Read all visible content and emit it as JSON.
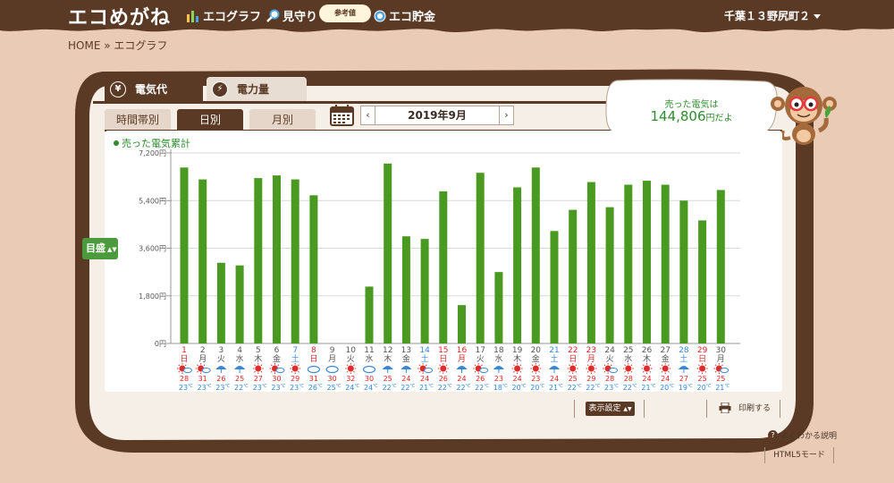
{
  "header": {
    "logo": "エコめがね",
    "nav": [
      {
        "label": "エコグラフ",
        "icon": "bar-chart-icon"
      },
      {
        "label": "見守り",
        "icon": "magnifier-icon"
      },
      {
        "label": "エコ貯金",
        "icon": "coin-icon"
      }
    ],
    "sample_badge": "参考値",
    "user_name": "千葉１３野尻町２"
  },
  "breadcrumb": "HOME » エコグラフ",
  "main_tabs": [
    {
      "label": "電気代",
      "icon_glyph": "¥",
      "icon": "yen-icon",
      "active": true
    },
    {
      "label": "電力量",
      "icon_glyph": "⚡",
      "icon": "lightning-icon",
      "active": false
    }
  ],
  "period_tabs": [
    {
      "label": "時間帯別",
      "active": false
    },
    {
      "label": "日別",
      "active": true
    },
    {
      "label": "月別",
      "active": false
    }
  ],
  "month_nav": {
    "prev": "‹",
    "label": "2019年9月",
    "next": "›"
  },
  "summary": {
    "line1": "売った電気は",
    "amount": "144,806",
    "suffix": "円だよ"
  },
  "legend": "売った電気累計",
  "scale_button": "目盛",
  "bottom": {
    "display_settings": "表示設定",
    "print": "印刷する",
    "help": "よくわかる説明",
    "html5": "HTML5モード"
  },
  "colors": {
    "brand_brown": "#5a3a25",
    "bar_green": "#4a9a22",
    "saturday_blue": "#3a87d9",
    "sunday_red": "#d9262a"
  },
  "chart_data": {
    "type": "bar",
    "ylim": [
      0,
      7200
    ],
    "yticks": [
      "0円",
      "1,800円",
      "3,600円",
      "5,400円",
      "7,200円"
    ],
    "ytick_values": [
      0,
      1800,
      3600,
      5400,
      7200
    ],
    "series": [
      {
        "name": "売った電気累計",
        "values": [
          6650,
          6200,
          3050,
          2950,
          6250,
          6350,
          6200,
          5600,
          0,
          0,
          2150,
          6800,
          4050,
          3950,
          5750,
          1450,
          6450,
          2700,
          5900,
          6650,
          4250,
          5050,
          6100,
          5150,
          6000,
          6150,
          6000,
          5400,
          4650,
          5800
        ]
      }
    ],
    "days": [
      {
        "day": "1",
        "weekday": "日",
        "weather": "sunny-cloudy",
        "high": "28",
        "low": "23"
      },
      {
        "day": "2",
        "weekday": "月",
        "weather": "sunny-cloudy",
        "high": "31",
        "low": "23"
      },
      {
        "day": "3",
        "weekday": "火",
        "weather": "rainy",
        "high": "26",
        "low": "23"
      },
      {
        "day": "4",
        "weekday": "水",
        "weather": "rainy",
        "high": "25",
        "low": "22"
      },
      {
        "day": "5",
        "weekday": "木",
        "weather": "sunny",
        "high": "27",
        "low": "23"
      },
      {
        "day": "6",
        "weekday": "金",
        "weather": "sunny-cloudy",
        "high": "30",
        "low": "23"
      },
      {
        "day": "7",
        "weekday": "土",
        "weather": "sunny",
        "high": "29",
        "low": "23"
      },
      {
        "day": "8",
        "weekday": "日",
        "weather": "cloudy",
        "high": "31",
        "low": "26"
      },
      {
        "day": "9",
        "weekday": "月",
        "weather": "cloudy",
        "high": "30",
        "low": "25"
      },
      {
        "day": "10",
        "weekday": "火",
        "weather": "sunny",
        "high": "32",
        "low": "24"
      },
      {
        "day": "11",
        "weekday": "水",
        "weather": "cloudy",
        "high": "30",
        "low": "24"
      },
      {
        "day": "12",
        "weekday": "木",
        "weather": "rainy",
        "high": "25",
        "low": "22"
      },
      {
        "day": "13",
        "weekday": "金",
        "weather": "rainy",
        "high": "24",
        "low": "22"
      },
      {
        "day": "14",
        "weekday": "土",
        "weather": "sunny-cloudy",
        "high": "24",
        "low": "21"
      },
      {
        "day": "15",
        "weekday": "日",
        "weather": "sunny",
        "high": "26",
        "low": "22"
      },
      {
        "day": "16",
        "weekday": "月",
        "weather": "rainy",
        "high": "24",
        "low": "22"
      },
      {
        "day": "17",
        "weekday": "火",
        "weather": "sunny-cloudy",
        "high": "26",
        "low": "22"
      },
      {
        "day": "18",
        "weekday": "水",
        "weather": "rainy",
        "high": "23",
        "low": "18"
      },
      {
        "day": "19",
        "weekday": "木",
        "weather": "sunny",
        "high": "24",
        "low": "20"
      },
      {
        "day": "20",
        "weekday": "金",
        "weather": "sunny",
        "high": "23",
        "low": "20"
      },
      {
        "day": "21",
        "weekday": "土",
        "weather": "rainy",
        "high": "24",
        "low": "21"
      },
      {
        "day": "22",
        "weekday": "日",
        "weather": "sunny",
        "high": "25",
        "low": "22"
      },
      {
        "day": "23",
        "weekday": "月",
        "weather": "sunny",
        "high": "29",
        "low": "22"
      },
      {
        "day": "24",
        "weekday": "火",
        "weather": "sunny-cloudy",
        "high": "28",
        "low": "23"
      },
      {
        "day": "25",
        "weekday": "水",
        "weather": "sunny",
        "high": "28",
        "low": "22"
      },
      {
        "day": "26",
        "weekday": "木",
        "weather": "sunny",
        "high": "24",
        "low": "21"
      },
      {
        "day": "27",
        "weekday": "金",
        "weather": "sunny",
        "high": "24",
        "low": "20"
      },
      {
        "day": "28",
        "weekday": "土",
        "weather": "rainy",
        "high": "27",
        "low": "19"
      },
      {
        "day": "29",
        "weekday": "日",
        "weather": "sunny",
        "high": "25",
        "low": "20"
      },
      {
        "day": "30",
        "weekday": "月",
        "weather": "sunny-cloudy",
        "high": "25",
        "low": "21"
      }
    ],
    "temp_unit": "℃",
    "highlight_days": {
      "blue": [
        "7",
        "14",
        "21",
        "28"
      ],
      "red": [
        "1",
        "8",
        "15",
        "16",
        "22",
        "23",
        "29"
      ]
    }
  }
}
